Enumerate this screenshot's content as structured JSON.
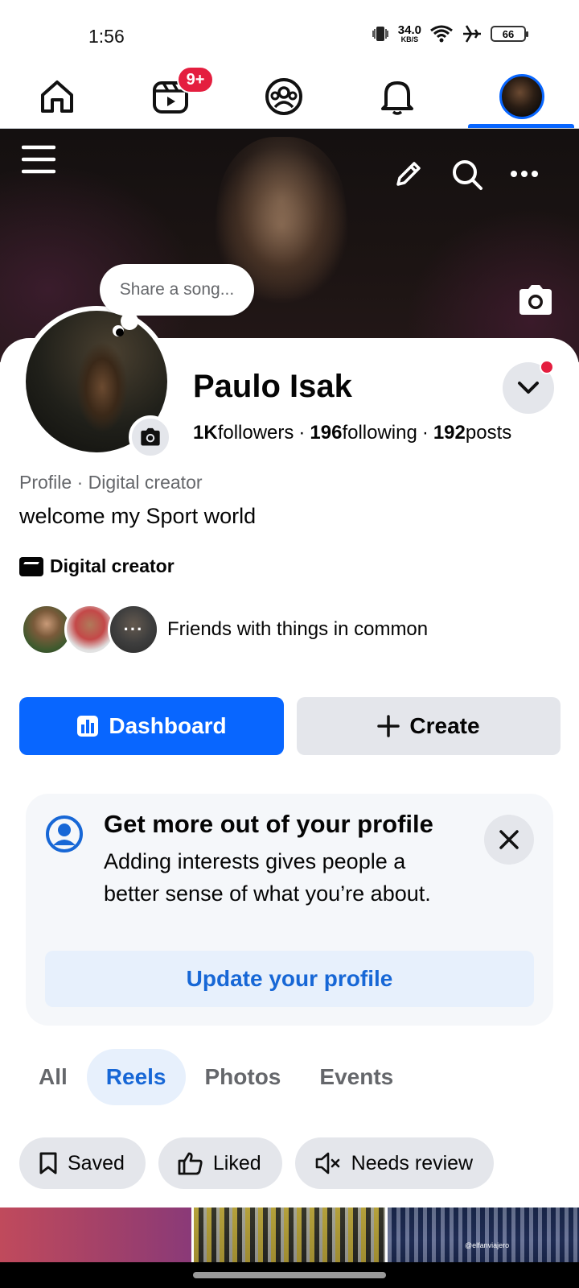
{
  "status_bar": {
    "time": "1:56",
    "net_speed": "34.0",
    "net_unit": "KB/S",
    "battery": "66"
  },
  "nav": {
    "badge": "9+",
    "active_tab": "profile",
    "items": [
      "home-icon",
      "reels-icon",
      "friends-icon",
      "notifications-icon",
      "profile-avatar"
    ]
  },
  "cover": {
    "song_placeholder": "Share a song..."
  },
  "profile": {
    "name": "Paulo Isak",
    "followers_count": "1K",
    "followers_label": "followers",
    "following_count": "196",
    "following_label": "following",
    "posts_count": "192",
    "posts_label": "posts",
    "separator": "·",
    "category": "Profile · Digital creator",
    "bio": "welcome my Sport world",
    "creator_label": "Digital creator",
    "friends_text": "Friends with things in common",
    "friends_more": "···"
  },
  "actions": {
    "dashboard_label": "Dashboard",
    "create_label": "Create"
  },
  "card": {
    "title": "Get more out of your profile",
    "text": "Adding interests gives people a better sense of what you’re about.",
    "cta": "Update your profile"
  },
  "tabs": [
    {
      "label": "All",
      "active": false
    },
    {
      "label": "Reels",
      "active": true
    },
    {
      "label": "Photos",
      "active": false
    },
    {
      "label": "Events",
      "active": false
    }
  ],
  "filters": [
    {
      "label": "Saved",
      "icon": "bookmark-icon"
    },
    {
      "label": "Liked",
      "icon": "thumbs-up-icon"
    },
    {
      "label": "Needs review",
      "icon": "muted-speaker-icon"
    }
  ],
  "thumbnails": {
    "watermark": "@elfanviajero"
  },
  "colors": {
    "accent": "#0866ff",
    "badge": "#e41e3f",
    "link": "#1767d6",
    "chip_bg": "#e4e6eb"
  }
}
